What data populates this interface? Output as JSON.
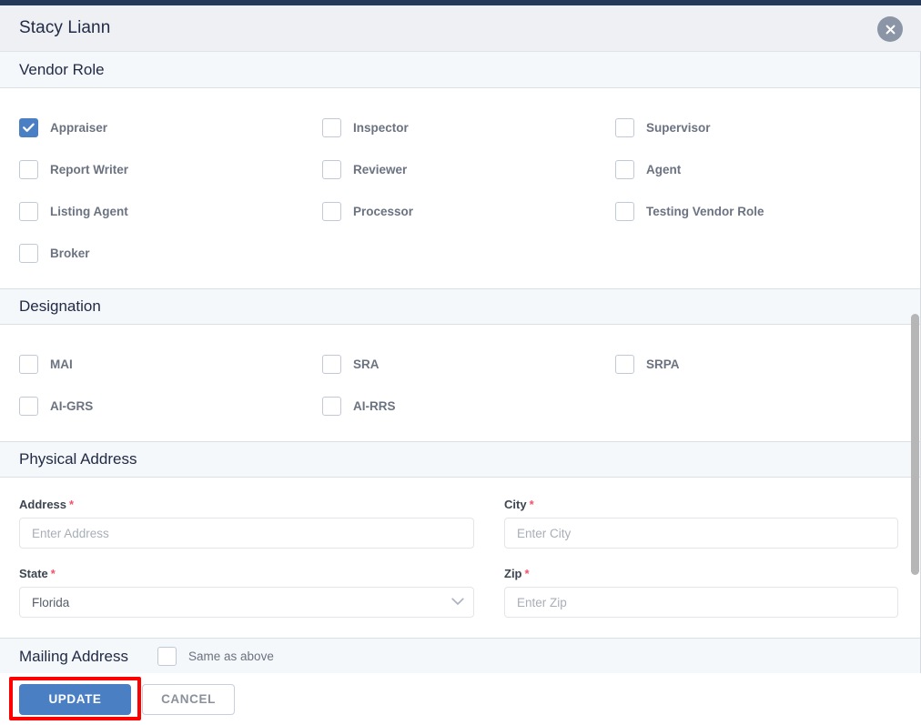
{
  "modal": {
    "title": "Stacy Liann",
    "close_icon": "close-icon"
  },
  "sections": [
    {
      "id": "vendor-role",
      "title": "Vendor Role",
      "checkboxes": [
        {
          "label": "Appraiser",
          "checked": true,
          "col": 1,
          "row": 1
        },
        {
          "label": "Inspector",
          "checked": false,
          "col": 2,
          "row": 1
        },
        {
          "label": "Supervisor",
          "checked": false,
          "col": 3,
          "row": 1
        },
        {
          "label": "Report Writer",
          "checked": false,
          "col": 1,
          "row": 2
        },
        {
          "label": "Reviewer",
          "checked": false,
          "col": 2,
          "row": 2
        },
        {
          "label": "Agent",
          "checked": false,
          "col": 3,
          "row": 2
        },
        {
          "label": "Listing Agent",
          "checked": false,
          "col": 1,
          "row": 3
        },
        {
          "label": "Processor",
          "checked": false,
          "col": 2,
          "row": 3
        },
        {
          "label": "Testing Vendor Role",
          "checked": false,
          "col": 3,
          "row": 3
        },
        {
          "label": "Broker",
          "checked": false,
          "col": 1,
          "row": 4
        }
      ]
    },
    {
      "id": "designation",
      "title": "Designation",
      "checkboxes": [
        {
          "label": "MAI",
          "checked": false,
          "col": 1,
          "row": 1
        },
        {
          "label": "SRA",
          "checked": false,
          "col": 2,
          "row": 1
        },
        {
          "label": "SRPA",
          "checked": false,
          "col": 3,
          "row": 1
        },
        {
          "label": "AI-GRS",
          "checked": false,
          "col": 1,
          "row": 2
        },
        {
          "label": "AI-RRS",
          "checked": false,
          "col": 2,
          "row": 2
        }
      ]
    },
    {
      "id": "physical-address",
      "title": "Physical Address"
    },
    {
      "id": "mailing-address",
      "title": "Mailing Address",
      "same_as_above_label": "Same as above",
      "same_as_above_checked": false
    }
  ],
  "physical_address_form": {
    "address": {
      "label": "Address",
      "required": true,
      "required_mark": "*",
      "value": "",
      "placeholder": "Enter Address"
    },
    "city": {
      "label": "City",
      "required": true,
      "required_mark": "*",
      "value": "",
      "placeholder": "Enter City"
    },
    "state": {
      "label": "State",
      "required": true,
      "required_mark": "*",
      "value": "Florida",
      "chevron_icon": "chevron-down-icon"
    },
    "zip": {
      "label": "Zip",
      "required": true,
      "required_mark": "*",
      "value": "",
      "placeholder": "Enter Zip"
    }
  },
  "footer": {
    "update_label": "UPDATE",
    "cancel_label": "CANCEL"
  },
  "colors": {
    "accent_blue": "#4b7fc4",
    "header_bg": "#eef0f4",
    "section_bg": "#f5f8fb",
    "top_strip": "#253858",
    "required_red": "#f4516c",
    "annotation_red": "#fe0000",
    "scrollbar_thumb": "#b6b6b6"
  }
}
